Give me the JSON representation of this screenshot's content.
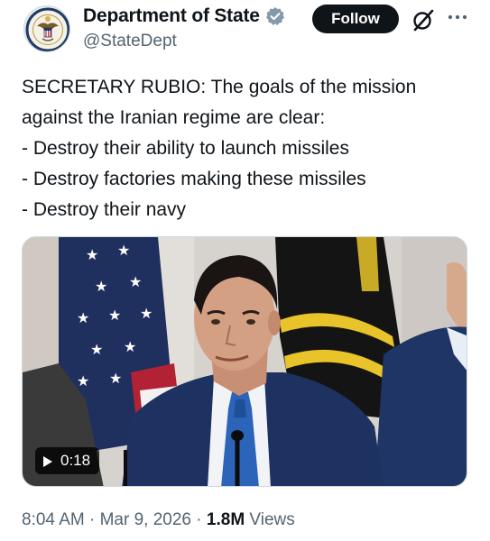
{
  "account": {
    "display_name": "Department of State",
    "handle": "@StateDept",
    "avatar_icon": "department-of-state-seal",
    "verified_icon": "government-verified-badge-icon"
  },
  "header": {
    "follow_label": "Follow",
    "grok_icon": "grok-icon",
    "more_icon": "more-options-icon"
  },
  "tweet": {
    "lines": [
      "SECRETARY RUBIO: The goals of the mission",
      "against the Iranian regime are clear:",
      "- Destroy their ability to launch missiles",
      "- Destroy factories making these missiles",
      "- Destroy their navy"
    ]
  },
  "media": {
    "type": "video",
    "duration": "0:18",
    "play_icon": "play-icon"
  },
  "meta": {
    "time": "8:04 AM",
    "separator": " · ",
    "date": "Mar 9, 2026",
    "views_count": "1.8M",
    "views_label": " Views"
  },
  "colors": {
    "text_primary": "#0f1419",
    "text_secondary": "#536471",
    "follow_bg": "#0f1419",
    "verified_badge": "#829aab"
  }
}
